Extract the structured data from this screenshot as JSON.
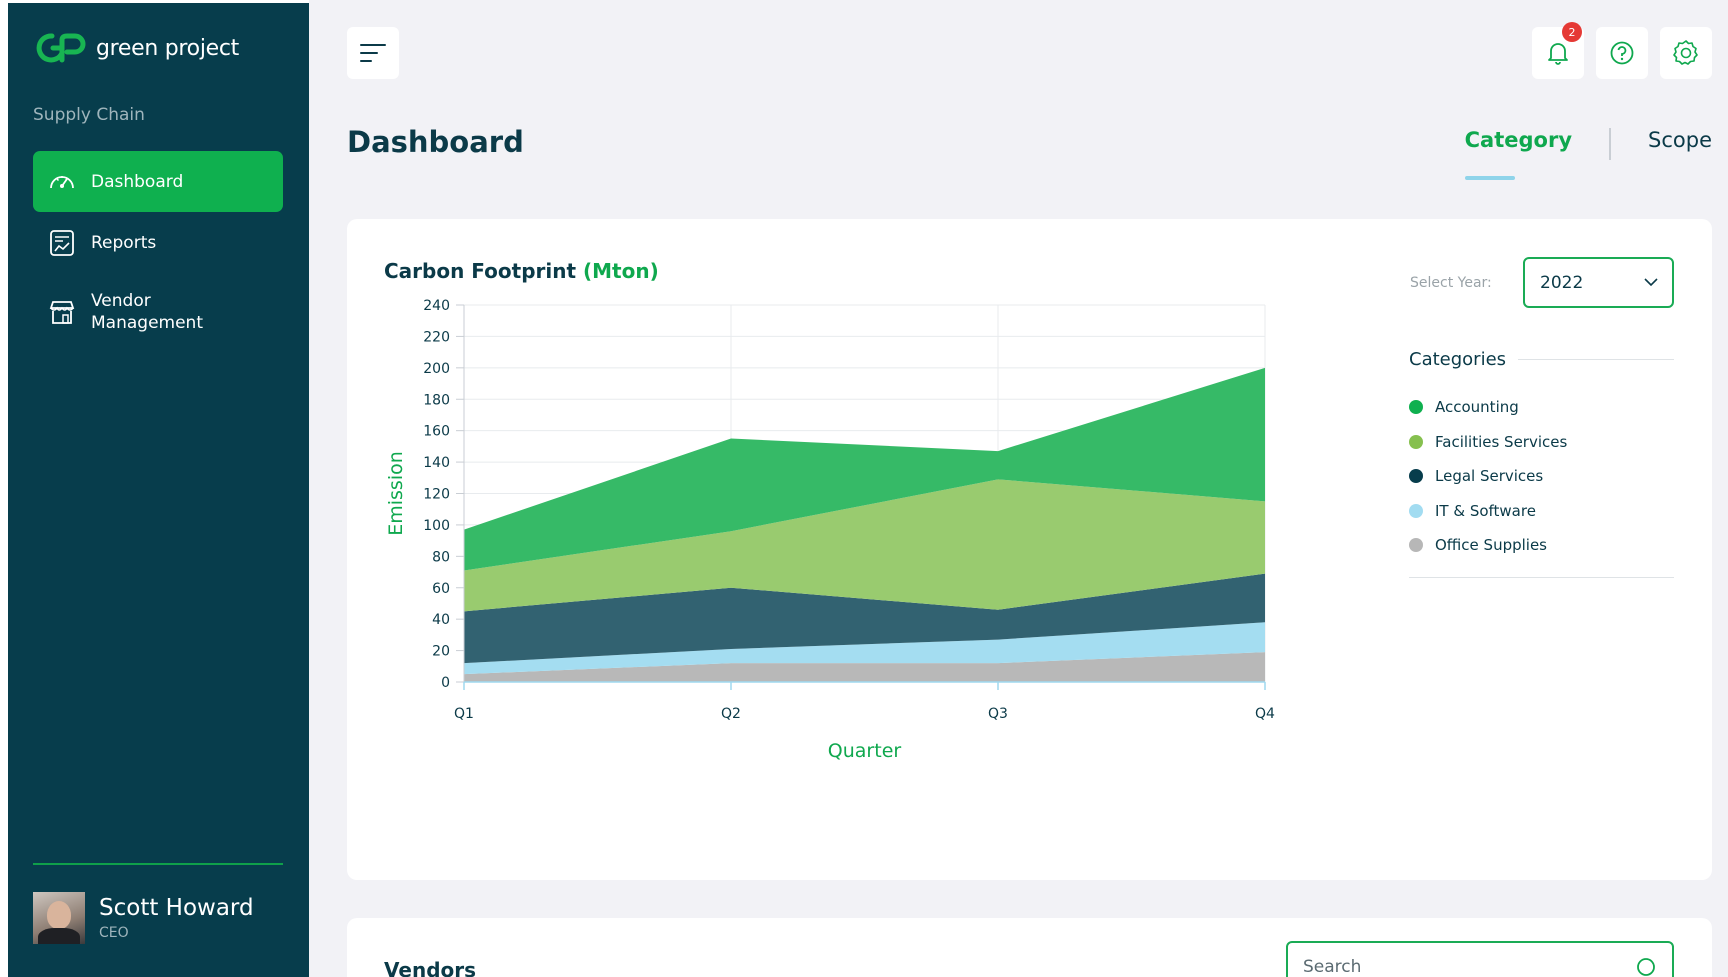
{
  "brand": {
    "name": "green project",
    "accent": "#0fb04f",
    "sidebar_bg": "#073d4c"
  },
  "sidebar": {
    "section_label": "Supply Chain",
    "items": [
      {
        "label": "Dashboard",
        "icon": "speedometer-icon",
        "active": true
      },
      {
        "label": "Reports",
        "icon": "report-chart-icon",
        "active": false
      },
      {
        "label": "Vendor Management",
        "icon": "storefront-icon",
        "active": false
      }
    ],
    "user": {
      "name": "Scott Howard",
      "role": "CEO"
    }
  },
  "header": {
    "title": "Dashboard",
    "notification_count": "2",
    "tabs": [
      {
        "label": "Category",
        "active": true
      },
      {
        "label": "Scope",
        "active": false
      }
    ]
  },
  "footprint_card": {
    "title": "Carbon Footprint",
    "unit": "(Mton)",
    "year_label": "Select Year:",
    "year_value": "2022",
    "legend_title": "Categories"
  },
  "vendors_card": {
    "title": "Vendors",
    "search_placeholder": "Search"
  },
  "chart_data": {
    "type": "area",
    "stacked": true,
    "xlabel": "Quarter",
    "ylabel": "Emission",
    "ylim": [
      0,
      240
    ],
    "yticks": [
      0,
      20,
      40,
      60,
      80,
      100,
      120,
      140,
      160,
      180,
      200,
      220,
      240
    ],
    "categories": [
      "Q1",
      "Q2",
      "Q3",
      "Q4"
    ],
    "grid": true,
    "legend_position": "right",
    "series": [
      {
        "name": "Office Supplies",
        "color": "#b7b7b7",
        "values": [
          5,
          12,
          12,
          19
        ]
      },
      {
        "name": "IT & Software",
        "color": "#a2dcf1",
        "values": [
          7,
          9,
          15,
          19
        ]
      },
      {
        "name": "Legal Services",
        "color": "#2e5f6e",
        "values": [
          33,
          39,
          19,
          31
        ]
      },
      {
        "name": "Facilities Services",
        "color": "#97ca6c",
        "values": [
          26,
          36,
          83,
          46
        ]
      },
      {
        "name": "Accounting",
        "color": "#32b964",
        "values": [
          26,
          59,
          18,
          85
        ]
      }
    ],
    "legend_order": [
      "Accounting",
      "Facilities Services",
      "Legal Services",
      "IT & Software",
      "Office Supplies"
    ]
  }
}
